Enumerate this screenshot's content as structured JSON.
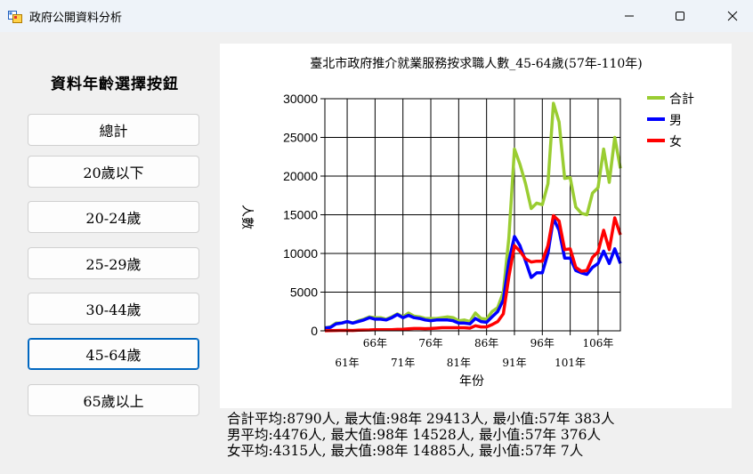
{
  "window": {
    "title": "政府公開資料分析",
    "icons": {
      "app": "form-app-icon",
      "minimize": "minimize-icon",
      "maximize": "maximize-icon",
      "close": "close-icon"
    }
  },
  "panel": {
    "heading": "資料年齡選擇按鈕",
    "buttons": [
      "總計",
      "20歲以下",
      "20-24歲",
      "25-29歲",
      "30-44歲",
      "45-64歲",
      "65歲以上"
    ],
    "selected": "45-64歲"
  },
  "chart_data": {
    "type": "line",
    "title": "臺北市政府推介就業服務按求職人數_45-64歲(57年-110年)",
    "xlabel": "年份",
    "ylabel": "人數",
    "ylim": [
      0,
      30000
    ],
    "yticks": [
      "0",
      "5000",
      "10000",
      "15000",
      "20000",
      "25000",
      "30000"
    ],
    "xticks_top": [
      "66年",
      "76年",
      "86年",
      "96年",
      "106年"
    ],
    "xticks_bottom": [
      "61年",
      "71年",
      "81年",
      "91年",
      "101年"
    ],
    "xtick_years_top": [
      66,
      76,
      86,
      96,
      106
    ],
    "xtick_years_bottom": [
      61,
      71,
      81,
      91,
      101
    ],
    "x_range": [
      57,
      110
    ],
    "grid": true,
    "legend_position": "top-right",
    "x": [
      57,
      58,
      59,
      60,
      61,
      62,
      63,
      64,
      65,
      66,
      67,
      68,
      69,
      70,
      71,
      72,
      73,
      74,
      75,
      76,
      77,
      78,
      79,
      80,
      81,
      82,
      83,
      84,
      85,
      86,
      87,
      88,
      89,
      90,
      91,
      92,
      93,
      94,
      95,
      96,
      97,
      98,
      99,
      100,
      101,
      102,
      103,
      104,
      105,
      106,
      107,
      108,
      109,
      110
    ],
    "series": [
      {
        "name": "合計",
        "color": "#9acd32",
        "values": [
          383,
          500,
          1000,
          1000,
          1200,
          1000,
          1300,
          1500,
          1800,
          1700,
          1700,
          1500,
          1800,
          2200,
          1800,
          2300,
          1900,
          1800,
          1600,
          1600,
          1600,
          1700,
          1800,
          1700,
          1300,
          1400,
          1200,
          2300,
          1600,
          1500,
          2500,
          3000,
          5000,
          12000,
          23500,
          21500,
          19000,
          15800,
          16500,
          16300,
          19000,
          29413,
          27000,
          19700,
          19800,
          16000,
          15200,
          15000,
          17800,
          18500,
          23500,
          19200,
          25000,
          21000
        ]
      },
      {
        "name": "男",
        "color": "#0000ff",
        "values": [
          376,
          450,
          900,
          1000,
          1200,
          1000,
          1200,
          1400,
          1700,
          1500,
          1500,
          1400,
          1700,
          2100,
          1700,
          2000,
          1700,
          1600,
          1400,
          1300,
          1400,
          1400,
          1400,
          1300,
          1000,
          1000,
          900,
          1600,
          1200,
          1100,
          1800,
          2500,
          4000,
          9000,
          12200,
          11000,
          9000,
          6900,
          7500,
          7500,
          10000,
          14528,
          13000,
          9400,
          9400,
          7800,
          7500,
          7300,
          8200,
          8700,
          10300,
          8700,
          10600,
          8700
        ]
      },
      {
        "name": "女",
        "color": "#ff0000",
        "values": [
          7,
          20,
          50,
          60,
          60,
          50,
          80,
          100,
          120,
          150,
          150,
          150,
          150,
          180,
          200,
          250,
          300,
          300,
          280,
          300,
          350,
          400,
          400,
          400,
          400,
          400,
          350,
          650,
          500,
          500,
          800,
          1200,
          2200,
          7000,
          11000,
          10300,
          9300,
          8900,
          9000,
          9000,
          11000,
          14885,
          14200,
          10500,
          10600,
          8200,
          7700,
          7800,
          9500,
          10200,
          13000,
          10500,
          14600,
          12400
        ]
      }
    ]
  },
  "stats": [
    "合計平均:8790人, 最大值:98年 29413人, 最小值:57年 383人",
    "男平均:4476人, 最大值:98年 14528人, 最小值:57年 376人",
    "女平均:4315人, 最大值:98年 14885人, 最小值:57年 7人"
  ]
}
